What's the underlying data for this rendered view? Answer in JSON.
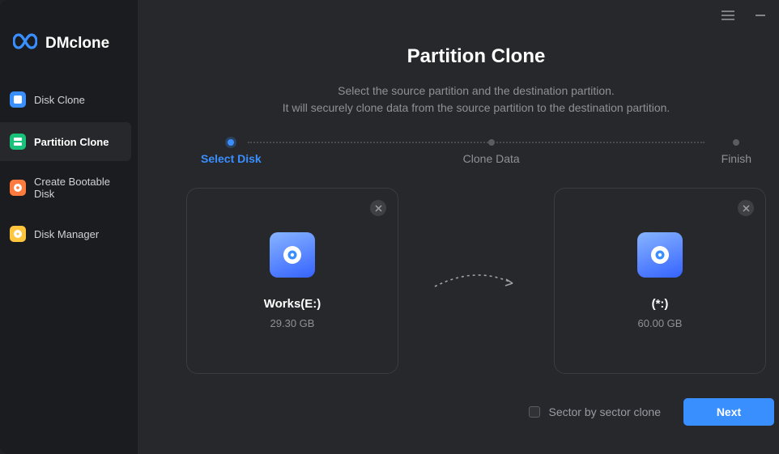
{
  "app": {
    "name": "DMclone"
  },
  "sidebar": {
    "items": [
      {
        "label": "Disk Clone",
        "icon": "disk-clone-icon",
        "color": "#3a8fff"
      },
      {
        "label": "Partition Clone",
        "icon": "partition-clone-icon",
        "color": "#18c27a"
      },
      {
        "label": "Create Bootable Disk",
        "icon": "bootable-disk-icon",
        "color": "#ff7a3d"
      },
      {
        "label": "Disk Manager",
        "icon": "disk-manager-icon",
        "color": "#ffc53d"
      }
    ],
    "active_index": 1
  },
  "page": {
    "title": "Partition Clone",
    "desc_line1": "Select the source partition and the destination partition.",
    "desc_line2": "It will securely clone data from the source partition to the destination partition."
  },
  "steps": {
    "items": [
      {
        "label": "Select Disk"
      },
      {
        "label": "Clone Data"
      },
      {
        "label": "Finish"
      }
    ],
    "active_index": 0
  },
  "source": {
    "title": "Works(E:)",
    "size": "29.30 GB"
  },
  "destination": {
    "title": "(*:)",
    "size": "60.00 GB"
  },
  "footer": {
    "checkbox_label": "Sector by sector clone",
    "next_label": "Next"
  }
}
